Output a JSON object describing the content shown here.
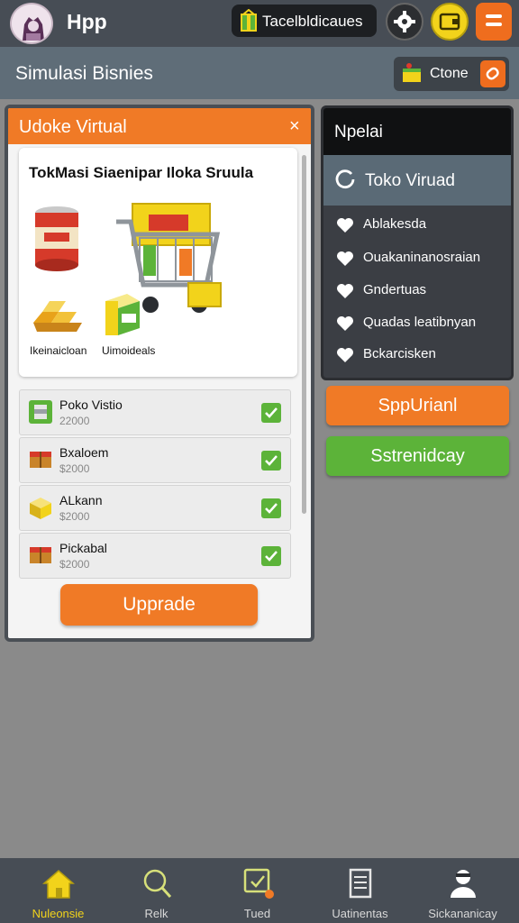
{
  "header": {
    "app_title": "Hpp",
    "badge_label": "Tacelbldicaues",
    "icons": {
      "avatar": "avatar-portrait",
      "badge": "gift-icon",
      "gear": "gear-icon",
      "yellow": "wallet-icon",
      "menu": "menu-icon"
    }
  },
  "subheader": {
    "title": "Simulasi Bisnies",
    "clone_label": "Ctone",
    "icons": {
      "clone": "store-icon",
      "edit": "edit-icon"
    }
  },
  "left_panel": {
    "title": "Udoke Virtual",
    "close_label": "×",
    "promo": {
      "title": "TokMasi Siaenipar Iloka Sruula",
      "caption_1": "Ikeinaicloan",
      "caption_2": "Uimoideals"
    },
    "items": [
      {
        "name": "Poko Vistio",
        "price": "22000",
        "icon": "can-icon"
      },
      {
        "name": "Bxaloem",
        "price": "$2000",
        "icon": "crate-icon"
      },
      {
        "name": "ALkann",
        "price": "$2000",
        "icon": "box-icon"
      },
      {
        "name": "Pickabal",
        "price": "$2000",
        "icon": "crate-icon"
      }
    ],
    "upgrade_label": "Upprade"
  },
  "right_panel": {
    "title": "Npelai",
    "selected": "Toko Viruad",
    "items": [
      "Ablakesda",
      "Ouakaninanosraian",
      "Gndertuas",
      "Quadas leatibnyan",
      "Bckarcisken"
    ],
    "orange_button": "SppUrianl",
    "green_button": "Sstrenidcay"
  },
  "bottom_nav": [
    {
      "label": "Nuleonsie",
      "icon": "home-icon",
      "active": true
    },
    {
      "label": "Relk",
      "icon": "search-icon",
      "active": false
    },
    {
      "label": "Tued",
      "icon": "chat-icon",
      "active": false
    },
    {
      "label": "Uatinentas",
      "icon": "document-icon",
      "active": false
    },
    {
      "label": "Sickananicay",
      "icon": "profile-icon",
      "active": false
    }
  ],
  "colors": {
    "accent_orange": "#f07a26",
    "accent_green": "#5cb339",
    "accent_yellow": "#f2d31b",
    "bar_dark": "#474d55"
  }
}
